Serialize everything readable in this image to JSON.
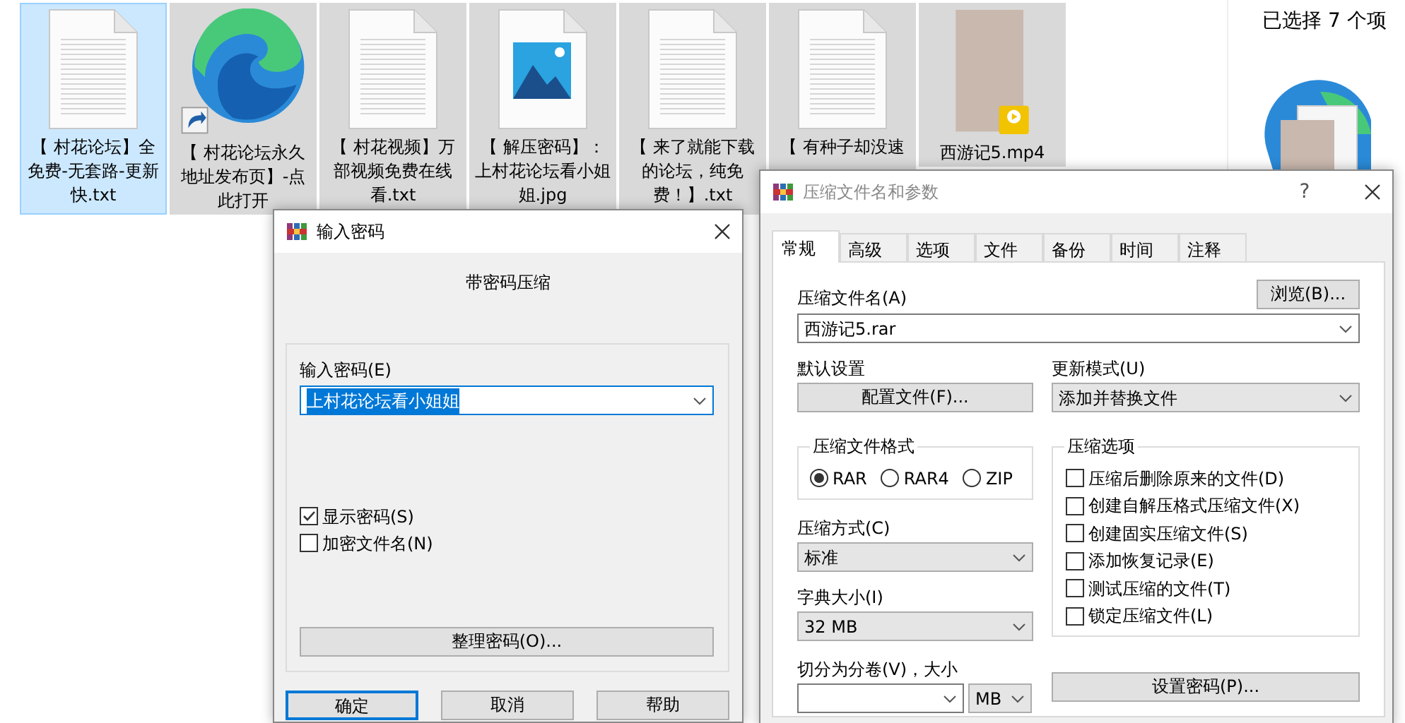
{
  "explorer": {
    "files": [
      {
        "name": "【 村花论坛】全免费-无套路-更新快.txt",
        "kind": "text",
        "selected": true,
        "focused": true
      },
      {
        "name": "【 村花论坛永久地址发布页】-点此打开",
        "kind": "shortcut",
        "selected": true,
        "focused": false
      },
      {
        "name": "【 村花视频】万部视频免费在线看.txt",
        "kind": "text",
        "selected": true,
        "focused": false
      },
      {
        "name": "【 解压密码】：上村花论坛看小姐姐.jpg",
        "kind": "image",
        "selected": true,
        "focused": false
      },
      {
        "name": "【 来了就能下载的论坛，纯免费！】.txt",
        "kind": "text",
        "selected": true,
        "focused": false
      },
      {
        "name": "【 有种子却没速",
        "kind": "text",
        "selected": true,
        "focused": false
      },
      {
        "name": "西游记5.mp4",
        "kind": "video",
        "selected": true,
        "focused": false
      }
    ],
    "selection_status": "已选择 7 个项"
  },
  "password_dialog": {
    "title": "输入密码",
    "heading": "带密码压缩",
    "password_label": "输入密码(E)",
    "password_value": "上村花论坛看小姐姐",
    "checkboxes": [
      {
        "label": "显示密码(S)",
        "checked": true
      },
      {
        "label": "加密文件名(N)",
        "checked": false
      }
    ],
    "organize_button": "整理密码(O)...",
    "buttons": [
      {
        "label": "确定",
        "default": true
      },
      {
        "label": "取消",
        "default": false
      },
      {
        "label": "帮助",
        "default": false
      }
    ]
  },
  "archive_dialog": {
    "title": "压缩文件名和参数",
    "help_mark": "?",
    "tabs": [
      {
        "label": "常规",
        "selected": true
      },
      {
        "label": "高级",
        "selected": false
      },
      {
        "label": "选项",
        "selected": false
      },
      {
        "label": "文件",
        "selected": false
      },
      {
        "label": "备份",
        "selected": false
      },
      {
        "label": "时间",
        "selected": false
      },
      {
        "label": "注释",
        "selected": false
      }
    ],
    "archive_name_label": "压缩文件名(A)",
    "browse_button": "浏览(B)...",
    "archive_name_value": "西游记5.rar",
    "profile_label": "默认设置",
    "profile_button": "配置文件(F)...",
    "update_mode_label": "更新模式(U)",
    "update_mode_value": "添加并替换文件",
    "format_group": {
      "title": "压缩文件格式",
      "options": [
        {
          "label": "RAR",
          "selected": true
        },
        {
          "label": "RAR4",
          "selected": false
        },
        {
          "label": "ZIP",
          "selected": false
        }
      ]
    },
    "method_label": "压缩方式(C)",
    "method_value": "标准",
    "dictionary_label": "字典大小(I)",
    "dictionary_value": "32 MB",
    "split_label": "切分为分卷(V)，大小",
    "split_unit": "MB",
    "options_group": {
      "title": "压缩选项",
      "checkboxes": [
        {
          "label": "压缩后删除原来的文件(D)",
          "checked": false
        },
        {
          "label": "创建自解压格式压缩文件(X)",
          "checked": false
        },
        {
          "label": "创建固实压缩文件(S)",
          "checked": false
        },
        {
          "label": "添加恢复记录(E)",
          "checked": false
        },
        {
          "label": "测试压缩的文件(T)",
          "checked": false
        },
        {
          "label": "锁定压缩文件(L)",
          "checked": false
        }
      ]
    },
    "password_button": "设置密码(P)..."
  }
}
